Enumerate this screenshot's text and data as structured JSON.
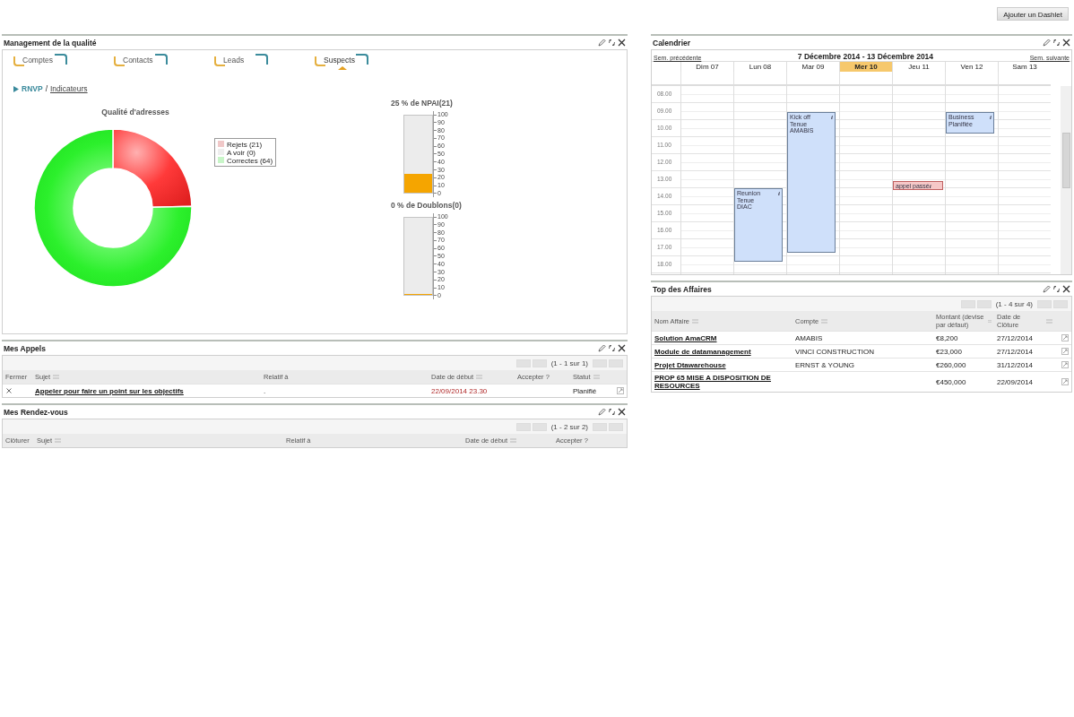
{
  "add_button": "Ajouter un Dashlet",
  "left_column": [
    {
      "kind": "quality",
      "title": "Management de la qualité",
      "tabs": [
        {
          "label": "Comptes",
          "selected": false
        },
        {
          "label": "Contacts",
          "selected": false
        },
        {
          "label": "Leads",
          "selected": false
        },
        {
          "label": "Suspects",
          "selected": true
        }
      ],
      "breadcrumb": {
        "current": "RNVP",
        "separator": "/",
        "link": "Indicateurs"
      },
      "donut": {
        "chart_data": {
          "type": "donut",
          "title": "Qualité d'adresses",
          "categories": [
            "Rejets (21)",
            "A voir  (0)",
            "Correctes (64)"
          ],
          "values": [
            21,
            0,
            64
          ],
          "legend": "right"
        }
      },
      "gauges": [
        {
          "title": "25 % de NPAI(21)",
          "level": 0.25,
          "ticks": [
            "100",
            "90",
            "80",
            "70",
            "60",
            "50",
            "40",
            "30",
            "20",
            "10",
            "0"
          ]
        },
        {
          "title": "0 % de Doublons(0)",
          "level": 0,
          "ticks": [
            "100",
            "90",
            "80",
            "70",
            "60",
            "50",
            "40",
            "30",
            "20",
            "10",
            "0"
          ]
        }
      ]
    },
    {
      "kind": "table",
      "title": "Mes Appels",
      "pager": "(1 - 1 sur 1)",
      "columns": [
        {
          "label": "Fermer",
          "sortable": false
        },
        {
          "label": "Sujet",
          "sortable": true
        },
        {
          "label": "Relatif à",
          "sortable": false
        },
        {
          "label": "Date de début",
          "sortable": true
        },
        {
          "label": "Accepter ?",
          "sortable": false
        },
        {
          "label": "Statut",
          "sortable": true
        }
      ],
      "rows": [
        {
          "cells": [
            {
              "kind": "close"
            },
            {
              "kind": "link",
              "text": "Appeler pour faire un point sur les objectifs"
            },
            {
              "kind": "text",
              "text": "."
            },
            {
              "kind": "date",
              "text": "22/09/2014 23.30",
              "overdue": true
            },
            {
              "kind": "blank"
            },
            {
              "kind": "text",
              "text": "Planifié"
            },
            {
              "kind": "edit"
            }
          ]
        }
      ]
    },
    {
      "kind": "table",
      "title": "Mes Rendez-vous",
      "pager": "(1 - 2 sur 2)",
      "columns": [
        {
          "label": "Clôturer",
          "sortable": false
        },
        {
          "label": "Sujet",
          "sortable": true
        },
        {
          "label": "Relatif à",
          "sortable": false
        },
        {
          "label": "Date de début",
          "sortable": true
        },
        {
          "label": "Accepter ?",
          "sortable": false
        }
      ]
    }
  ],
  "right_column": [
    {
      "kind": "calendar",
      "title": "Calendrier",
      "prev": "Sem. précédente",
      "range": "7 Décembre 2014 - 13 Décembre 2014",
      "next": "Sem. suivante",
      "hours": [
        "08.00",
        "09.00",
        "10.00",
        "11.00",
        "12.00",
        "13.00",
        "14.00",
        "15.00",
        "16.00",
        "17.00",
        "18.00"
      ],
      "days": [
        {
          "label": "Dim 07",
          "today": false
        },
        {
          "label": "Lun 08",
          "today": false,
          "events": [
            {
              "kind": "meeting",
              "lines": [
                "Reunion",
                "Tenue",
                "DIAC"
              ],
              "icon": "i"
            }
          ]
        },
        {
          "label": "Mar 09",
          "today": false,
          "events": [
            {
              "kind": "meeting",
              "lines": [
                "Kick off",
                "Tenue",
                "AMABIS"
              ],
              "icon": "i"
            }
          ]
        },
        {
          "label": "Mer 10",
          "today": true
        },
        {
          "label": "Jeu 11",
          "today": false,
          "events": [
            {
              "kind": "call",
              "lines": [
                "appel passé"
              ],
              "icon": "i"
            }
          ]
        },
        {
          "label": "Ven 12",
          "today": false,
          "events": [
            {
              "kind": "meeting",
              "lines": [
                "Business",
                "Planifiée"
              ],
              "icon": "i"
            }
          ]
        },
        {
          "label": "Sam 13",
          "today": false
        }
      ]
    },
    {
      "kind": "table",
      "title": "Top des Affaires",
      "pager": "(1 - 4 sur 4)",
      "columns": [
        {
          "label": "Nom Affaire",
          "sortable": true
        },
        {
          "label": "Compte",
          "sortable": true
        },
        {
          "label": "Montant (devise par défaut)",
          "sortable": true
        },
        {
          "label": "Date de Clôture",
          "sortable": true
        }
      ],
      "rows": [
        {
          "cells": [
            {
              "kind": "link",
              "text": "Solution AmaCRM"
            },
            {
              "kind": "text",
              "text": "AMABIS"
            },
            {
              "kind": "text",
              "text": "€8,200"
            },
            {
              "kind": "text",
              "text": "27/12/2014"
            },
            {
              "kind": "edit"
            }
          ]
        },
        {
          "cells": [
            {
              "kind": "link",
              "text": "Module de datamanagement"
            },
            {
              "kind": "text",
              "text": "VINCI CONSTRUCTION"
            },
            {
              "kind": "text",
              "text": "€23,000"
            },
            {
              "kind": "text",
              "text": "27/12/2014"
            },
            {
              "kind": "edit"
            }
          ]
        },
        {
          "cells": [
            {
              "kind": "link",
              "text": "Projet Dtawarehouse"
            },
            {
              "kind": "text",
              "text": "ERNST & YOUNG"
            },
            {
              "kind": "text",
              "text": "€260,000"
            },
            {
              "kind": "text",
              "text": "31/12/2014"
            },
            {
              "kind": "edit"
            }
          ]
        },
        {
          "cells": [
            {
              "kind": "link",
              "text": "PROP 65 MISE A DISPOSITION DE RESOURCES"
            },
            {
              "kind": "blank"
            },
            {
              "kind": "text",
              "text": "€450,000"
            },
            {
              "kind": "text",
              "text": "22/09/2014"
            },
            {
              "kind": "edit"
            }
          ]
        }
      ]
    }
  ]
}
